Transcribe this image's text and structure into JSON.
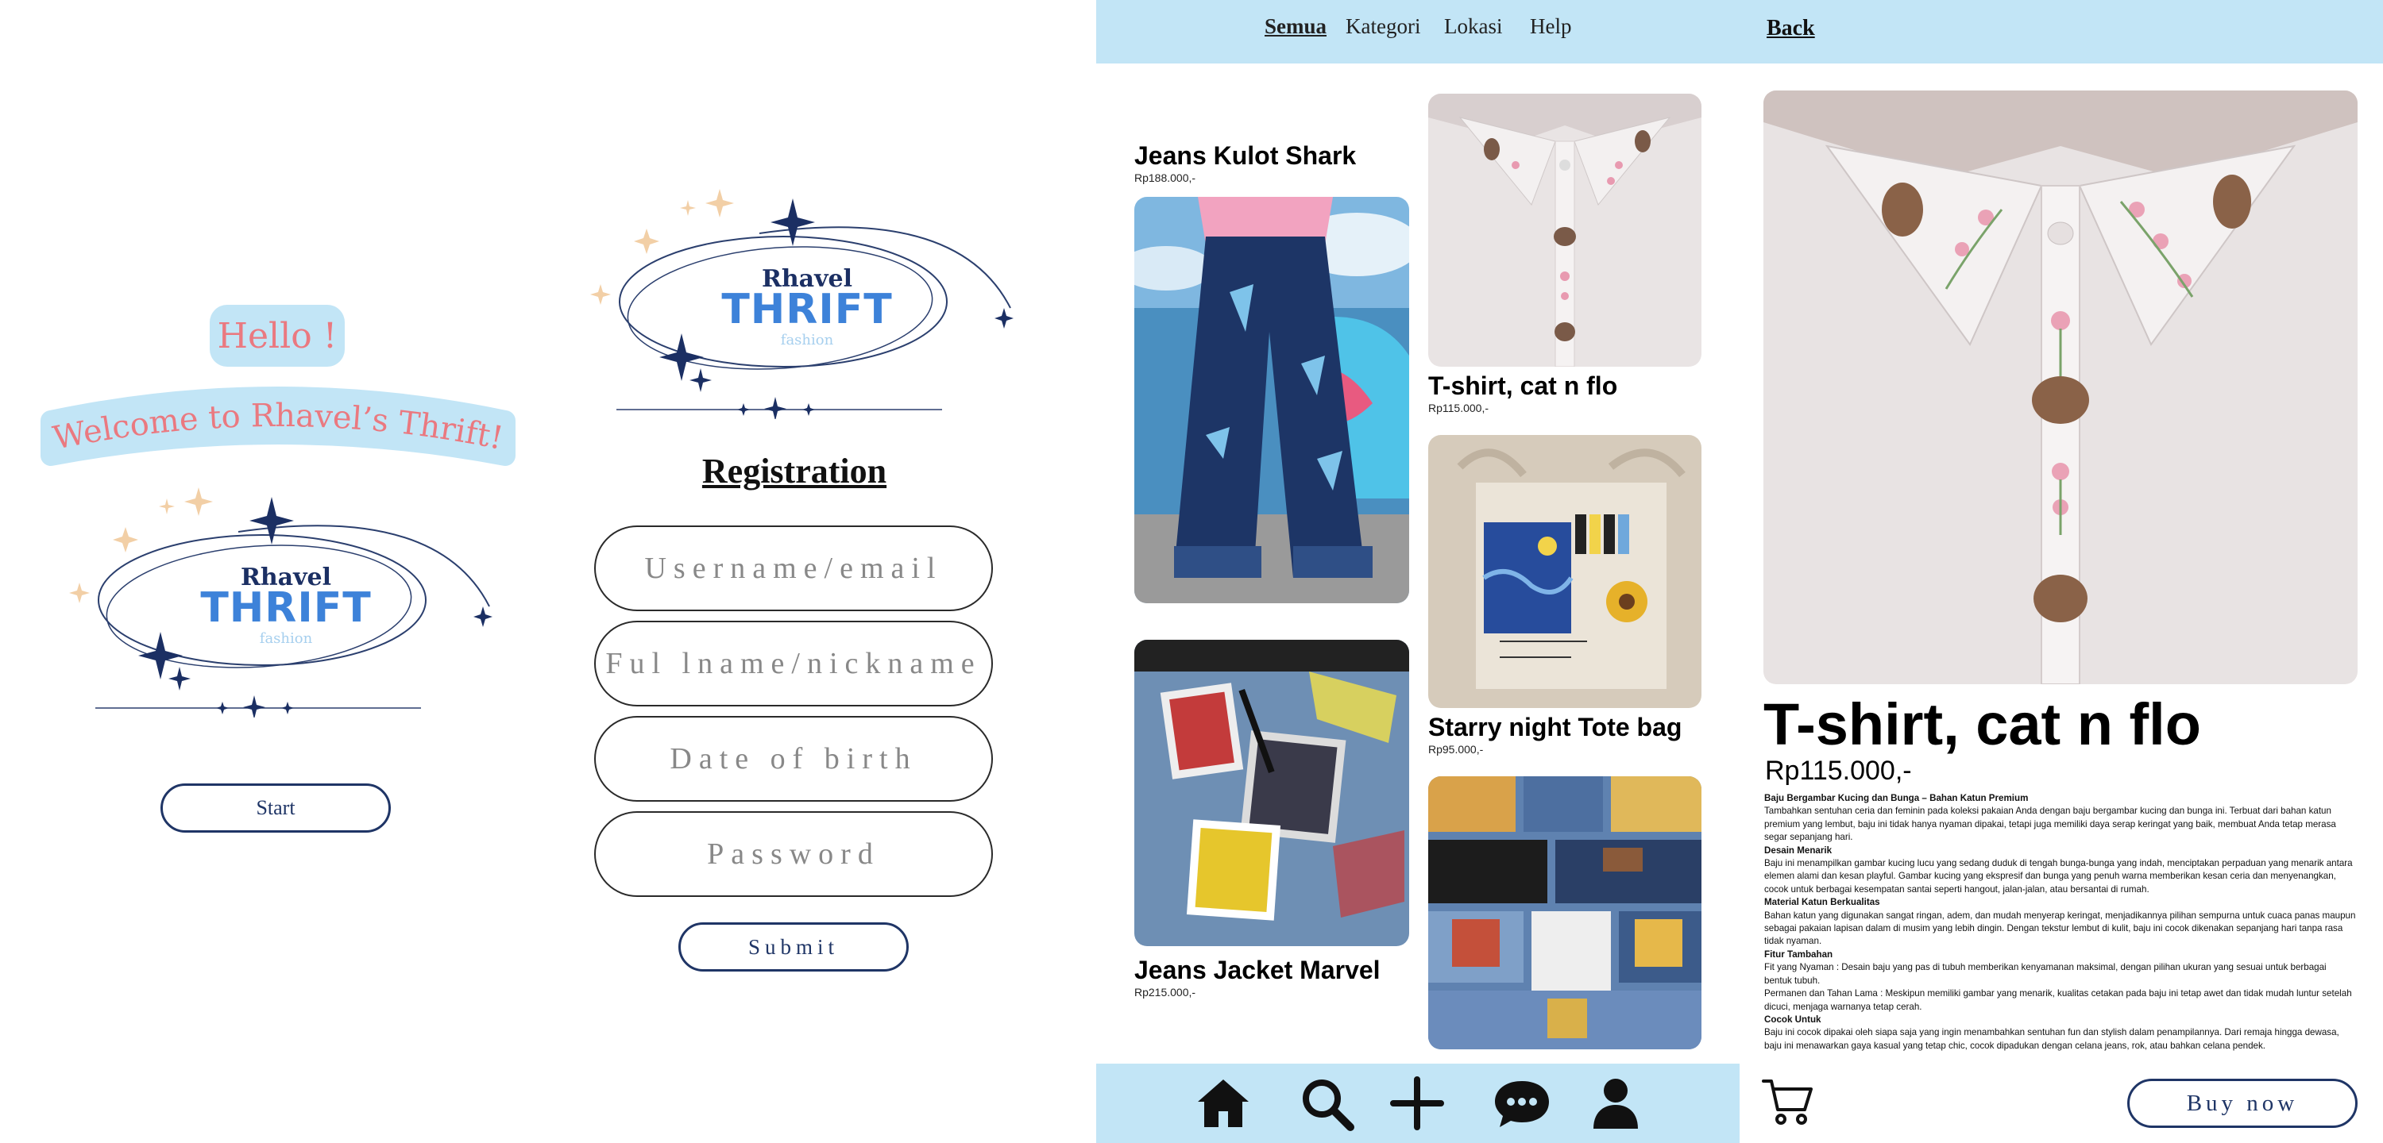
{
  "welcome": {
    "hello": "Hello !",
    "welcome_text": "Welcome to Rhavel’s Thrift!",
    "start_label": "Start"
  },
  "logo": {
    "line1": "Rhavel",
    "line2": "THRIFT",
    "line3": "fashion"
  },
  "registration": {
    "title": "Registration",
    "fields": [
      {
        "placeholder": "Username/email"
      },
      {
        "placeholder": "Ful lname/nickname"
      },
      {
        "placeholder": "Date of birth"
      },
      {
        "placeholder": "Password"
      }
    ],
    "submit_label": "Submit"
  },
  "catalog": {
    "nav": [
      "Semua",
      "Kategori",
      "Lokasi",
      "Help"
    ],
    "active_nav": "Semua",
    "products": [
      {
        "title": "Jeans Kulot Shark",
        "price": "Rp188.000,-"
      },
      {
        "title": "T-shirt, cat n flo",
        "price": "Rp115.000,-"
      },
      {
        "title": "Starry night Tote bag",
        "price": "Rp95.000,-"
      },
      {
        "title": "Jeans Jacket Marvel",
        "price": "Rp215.000,-"
      }
    ],
    "bottom_nav": [
      "home-icon",
      "search-icon",
      "plus-icon",
      "chat-icon",
      "profile-icon"
    ]
  },
  "detail": {
    "back_label": "Back",
    "title": "T-shirt, cat n flo",
    "price": "Rp115.000,-",
    "description": [
      {
        "heading": "Baju Bergambar Kucing dan Bunga – Bahan Katun Premium",
        "text": "Tambahkan sentuhan ceria dan feminin pada koleksi pakaian Anda dengan baju bergambar kucing dan bunga ini. Terbuat dari bahan katun premium yang lembut, baju ini tidak hanya nyaman dipakai, tetapi juga memiliki daya serap keringat yang baik, membuat Anda tetap merasa segar sepanjang hari."
      },
      {
        "heading": "Desain Menarik",
        "text": "Baju ini menampilkan gambar kucing lucu yang sedang duduk di tengah bunga-bunga yang indah, menciptakan perpaduan yang menarik antara elemen alami dan kesan playful. Gambar kucing yang ekspresif dan bunga yang penuh warna memberikan kesan ceria dan menyenangkan, cocok untuk berbagai kesempatan santai seperti hangout, jalan-jalan, atau bersantai di rumah."
      },
      {
        "heading": "Material Katun Berkualitas",
        "text": "Bahan katun yang digunakan sangat ringan, adem, dan mudah menyerap keringat, menjadikannya pilihan sempurna untuk cuaca panas maupun sebagai pakaian lapisan dalam di musim yang lebih dingin. Dengan tekstur lembut di kulit, baju ini cocok dikenakan sepanjang hari tanpa rasa tidak nyaman."
      },
      {
        "heading": "Fitur Tambahan",
        "text": "Fit yang Nyaman : Desain baju yang pas di tubuh memberikan kenyamanan maksimal, dengan pilihan ukuran yang sesuai untuk berbagai bentuk tubuh.\nPermanen dan Tahan Lama : Meskipun memiliki gambar yang menarik, kualitas cetakan pada baju ini tetap awet dan tidak mudah luntur setelah dicuci, menjaga warnanya tetap cerah."
      },
      {
        "heading": "Cocok Untuk",
        "text": "Baju ini cocok dipakai oleh siapa saja yang ingin menambahkan sentuhan fun dan stylish dalam penampilannya. Dari remaja hingga dewasa, baju ini menawarkan gaya kasual yang tetap chic, cocok dipadukan dengan celana jeans, rok, atau bahkan celana pendek."
      }
    ],
    "buy_label": "Buy now",
    "cart_icon": "cart-icon"
  },
  "colors": {
    "accent_blue": "#c2e5f6",
    "navy": "#1f3566",
    "pink": "#ea7980",
    "logo_blue": "#3d82d9"
  }
}
